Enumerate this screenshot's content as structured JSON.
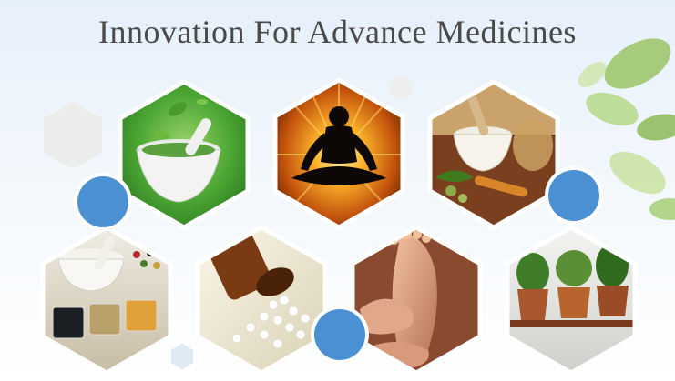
{
  "title": "Innovation For Advance Medicines",
  "tiles": [
    {
      "name": "mortar-herbal-tile",
      "icon": "mortar-pestle-leaves-icon"
    },
    {
      "name": "meditation-tile",
      "icon": "meditation-silhouette-icon"
    },
    {
      "name": "herbal-ingredients-tile",
      "icon": "mortar-roots-turmeric-icon"
    },
    {
      "name": "spices-tile",
      "icon": "peppercorn-spices-icon"
    },
    {
      "name": "homeopathy-pills-tile",
      "icon": "pill-bottle-pellets-icon"
    },
    {
      "name": "reflexology-tile",
      "icon": "foot-massage-icon"
    },
    {
      "name": "potted-herbs-tile",
      "icon": "potted-herbs-icon"
    }
  ],
  "colors": {
    "accent_circle": "#4a90d2",
    "tile_border": "#ffffff",
    "green_bg": "#3f9a2e",
    "sunburst": "#f29a1f",
    "title_text": "#4a4a4a"
  }
}
